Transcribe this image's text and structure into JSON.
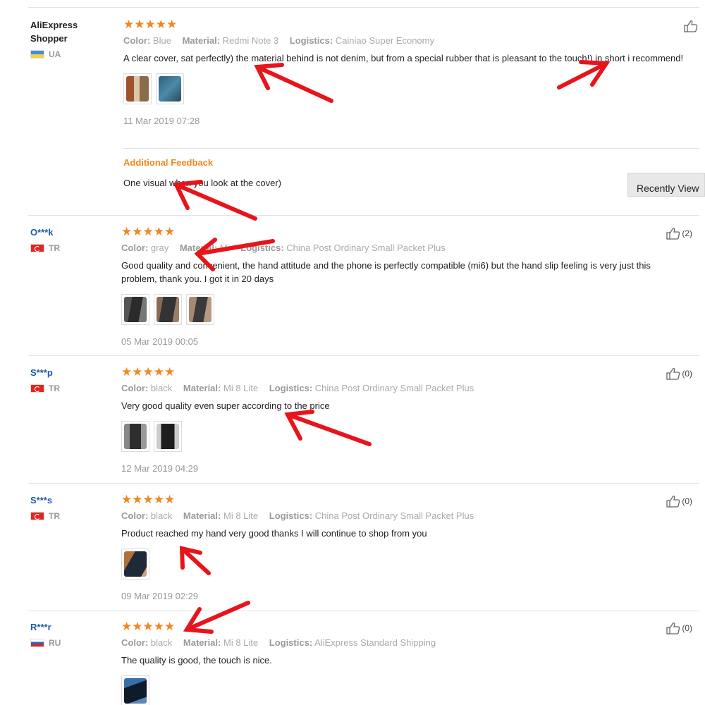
{
  "meta_labels": {
    "color": "Color:",
    "material": "Material:",
    "logistics": "Logistics:"
  },
  "reviews": [
    {
      "user": "AliExpress Shopper",
      "country": "UA",
      "stars": "★★★★★",
      "color": "Blue",
      "material": "Redmi Note 3",
      "logistics": "Cainiao Super Economy",
      "text": "A clear cover, sat perfectly) the material behind is not denim, but from a special rubber that is pleasant to the touch!) in short i recommend!",
      "date": "11 Mar 2019 07:28",
      "helpful": "",
      "additional": {
        "title": "Additional Feedback",
        "text": "One visual when you look at the cover)"
      }
    },
    {
      "user": "O***k",
      "country": "TR",
      "stars": "★★★★★",
      "color": "gray",
      "material": "Mi",
      "logistics": "China Post Ordinary Small Packet Plus",
      "text": "Good quality and convenient, the hand attitude and the phone is perfectly compatible (mi6) but the hand slip feeling is very just this problem, thank you. I got it in 20 days",
      "date": "05 Mar 2019 00:05",
      "helpful": "(2)"
    },
    {
      "user": "S***p",
      "country": "TR",
      "stars": "★★★★★",
      "color": "black",
      "material": "Mi 8 Lite",
      "logistics": "China Post Ordinary Small Packet Plus",
      "text": "Very good quality even super according to the price",
      "date": "12 Mar 2019 04:29",
      "helpful": "(0)"
    },
    {
      "user": "S***s",
      "country": "TR",
      "stars": "★★★★★",
      "color": "black",
      "material": "Mi 8 Lite",
      "logistics": "China Post Ordinary Small Packet Plus",
      "text": "Product reached my hand very good thanks I will continue to shop from you",
      "date": "09 Mar 2019 02:29",
      "helpful": "(0)"
    },
    {
      "user": "R***r",
      "country": "RU",
      "stars": "★★★★★",
      "color": "black",
      "material": "Mi 8 Lite",
      "logistics": "AliExpress Standard Shipping",
      "text": "The quality is good, the touch is nice.",
      "date": "",
      "helpful": "(0)"
    }
  ],
  "recently_viewed_label": "Recently View",
  "colors": {
    "star": "#f2871d",
    "username": "#1a5aa8",
    "arrow": "#e8141b",
    "additional_title": "#f2871d"
  },
  "icons": {
    "helpful": "thumbs-up-icon",
    "rating": "star-icon"
  }
}
